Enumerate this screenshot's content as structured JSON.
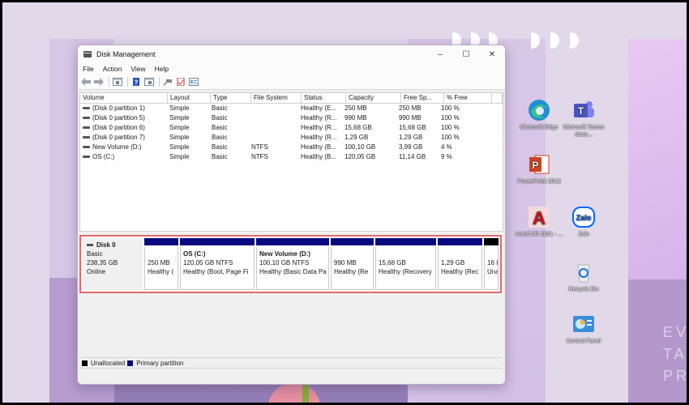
{
  "window": {
    "title": "Disk Management",
    "controls": {
      "minimize": "–",
      "maximize": "☐",
      "close": "✕"
    }
  },
  "menu": [
    "File",
    "Action",
    "View",
    "Help"
  ],
  "toolbar": [
    "back-icon",
    "forward-icon",
    "console-tree-icon",
    "help-icon",
    "show-pane-icon",
    "connect-icon",
    "properties-icon",
    "settings-icon"
  ],
  "volumes": {
    "columns": [
      "Volume",
      "Layout",
      "Type",
      "File System",
      "Status",
      "Capacity",
      "Free Sp...",
      "% Free"
    ],
    "rows": [
      {
        "volume": "(Disk 0 partition 1)",
        "layout": "Simple",
        "type": "Basic",
        "fs": "",
        "status": "Healthy (E...",
        "capacity": "250 MB",
        "free": "250 MB",
        "pct": "100 %"
      },
      {
        "volume": "(Disk 0 partition 5)",
        "layout": "Simple",
        "type": "Basic",
        "fs": "",
        "status": "Healthy (R...",
        "capacity": "990 MB",
        "free": "990 MB",
        "pct": "100 %"
      },
      {
        "volume": "(Disk 0 partition 6)",
        "layout": "Simple",
        "type": "Basic",
        "fs": "",
        "status": "Healthy (R...",
        "capacity": "15,68 GB",
        "free": "15,68 GB",
        "pct": "100 %"
      },
      {
        "volume": "(Disk 0 partition 7)",
        "layout": "Simple",
        "type": "Basic",
        "fs": "",
        "status": "Healthy (R...",
        "capacity": "1,29 GB",
        "free": "1,29 GB",
        "pct": "100 %"
      },
      {
        "volume": "New Volume (D:)",
        "layout": "Simple",
        "type": "Basic",
        "fs": "NTFS",
        "status": "Healthy (B...",
        "capacity": "100,10 GB",
        "free": "3,99 GB",
        "pct": "4 %"
      },
      {
        "volume": "OS (C:)",
        "layout": "Simple",
        "type": "Basic",
        "fs": "NTFS",
        "status": "Healthy (B...",
        "capacity": "120,05 GB",
        "free": "11,14 GB",
        "pct": "9 %"
      }
    ]
  },
  "disk": {
    "name": "Disk 0",
    "type": "Basic",
    "size": "238,35 GB",
    "state": "Online",
    "partitions": [
      {
        "name": "",
        "size": "250 MB",
        "status": "Healthy (",
        "kind": "primary"
      },
      {
        "name": "OS  (C:)",
        "size": "120,05 GB NTFS",
        "status": "Healthy (Boot, Page Fi",
        "kind": "primary"
      },
      {
        "name": "New Volume  (D:)",
        "size": "100,10 GB NTFS",
        "status": "Healthy (Basic Data Pa",
        "kind": "primary"
      },
      {
        "name": "",
        "size": "990 MB",
        "status": "Healthy (Re",
        "kind": "primary"
      },
      {
        "name": "",
        "size": "15,68 GB",
        "status": "Healthy (Recovery",
        "kind": "primary"
      },
      {
        "name": "",
        "size": "1,29 GB",
        "status": "Healthy (Rec",
        "kind": "primary"
      },
      {
        "name": "",
        "size": "16 I",
        "status": "Una",
        "kind": "unallocated"
      }
    ]
  },
  "legend": [
    {
      "label": "Unallocated",
      "color": "#000000"
    },
    {
      "label": "Primary partition",
      "color": "#0a0a80"
    }
  ],
  "desktop": {
    "icons": [
      {
        "label": "Microsoft Edge",
        "icon": "edge-icon"
      },
      {
        "label": "Microsoft Teams class...",
        "icon": "teams-icon"
      },
      {
        "label": "PowerPoint 2013",
        "icon": "powerpoint-icon"
      },
      {
        "label": "AutoCAD 2021 - ...",
        "icon": "autocad-icon"
      },
      {
        "label": "Zalo",
        "icon": "zalo-icon"
      },
      {
        "label": "Recycle Bin",
        "icon": "recycle-bin-icon"
      },
      {
        "label": "Control Panel",
        "icon": "control-panel-icon"
      }
    ],
    "wallpaper_text": [
      "EV",
      "TA",
      "PR"
    ]
  }
}
